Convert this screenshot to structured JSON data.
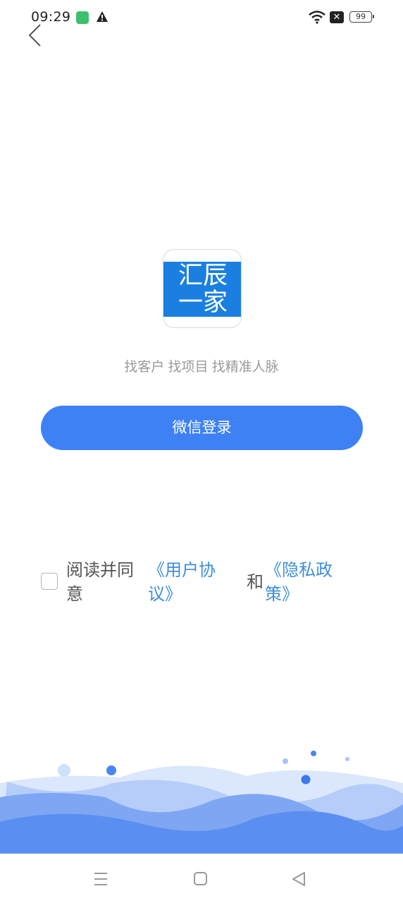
{
  "status_bar": {
    "time": "09:29",
    "battery": "99",
    "icons": [
      "app-icon",
      "warning-icon",
      "wifi-icon",
      "x-icon",
      "battery-icon"
    ]
  },
  "header": {
    "back_icon": "chevron-left-icon"
  },
  "logo": {
    "line1": "汇辰",
    "line2": "一家",
    "color": "#1a7fe0"
  },
  "tagline": "找客户 找项目 找精准人脉",
  "login_button": {
    "label": "微信登录",
    "color": "#3d81f5"
  },
  "agreement": {
    "prefix": "阅读并同意",
    "user_agreement": "《用户协议》",
    "and": "和",
    "privacy_policy": "《隐私政策》",
    "checked": false,
    "link_color": "#3d8fd9"
  },
  "nav_bar": {
    "icons": [
      "menu-icon",
      "home-icon",
      "back-triangle-icon"
    ]
  }
}
